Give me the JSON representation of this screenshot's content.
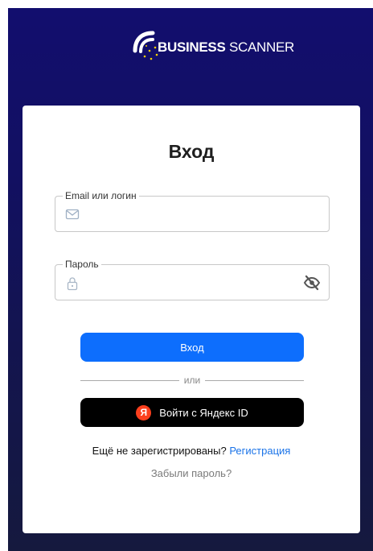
{
  "logo": {
    "brand_bold": "BUSINESS",
    "brand_light": "SCANNER"
  },
  "login": {
    "title": "Вход",
    "email_label": "Email или логин",
    "email_value": "",
    "email_placeholder": "",
    "password_label": "Пароль",
    "password_value": "",
    "password_placeholder": "",
    "submit_label": "Вход",
    "divider_text": "или",
    "yandex_label": "Войти с Яндекс ID",
    "yandex_logo_letter": "Я",
    "not_registered_text": "Ещё не зарегистрированы?",
    "register_link": "Регистрация",
    "forgot_link": "Забыли пароль?"
  },
  "colors": {
    "background_top": "#120e6e",
    "background_bottom": "#15193e",
    "primary_button": "#0d6efd",
    "yandex_button": "#000000",
    "yandex_logo": "#fc3f1d",
    "link": "#1a73e8"
  },
  "icons": {
    "logo": "wifi-signal-stars-logo",
    "email": "envelope-icon",
    "password": "lock-icon",
    "visibility": "eye-slash-icon",
    "yandex": "yandex-logo-icon"
  }
}
